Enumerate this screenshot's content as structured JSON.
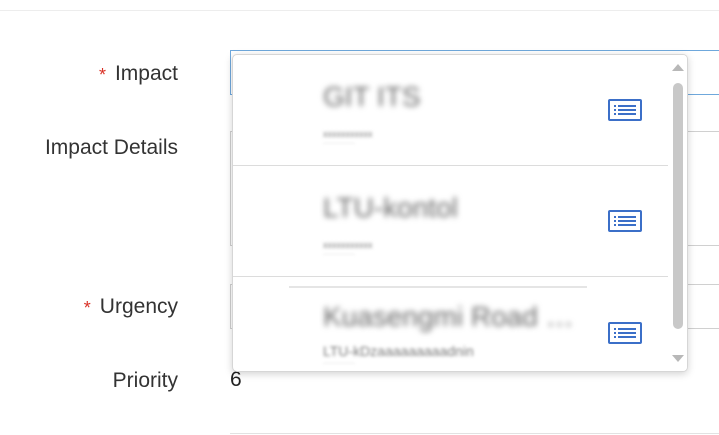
{
  "form": {
    "impact_label": "Impact",
    "impact_required": "*",
    "impact_details_label": "Impact Details",
    "urgency_label": "Urgency",
    "urgency_required": "*",
    "priority_label": "Priority",
    "priority_value": "6"
  },
  "dropdown": {
    "items": [
      {
        "title": "GIT ITS",
        "sub": "xxxxxxxxxxx",
        "sub2": "················",
        "icon": "list-icon"
      },
      {
        "title": "LTU-kontol",
        "sub": "xxxxxxxxxxx",
        "sub2": "················",
        "icon": "list-icon"
      },
      {
        "title": "Kuasengmi Road Ru...",
        "sub": "LTU-kDzaaaaaaaaadnin",
        "sub2": "················",
        "icon": "list-icon"
      }
    ]
  },
  "colors": {
    "required": "#d93025",
    "accent": "#3b6fc8",
    "active_border": "#6fa8dc"
  }
}
